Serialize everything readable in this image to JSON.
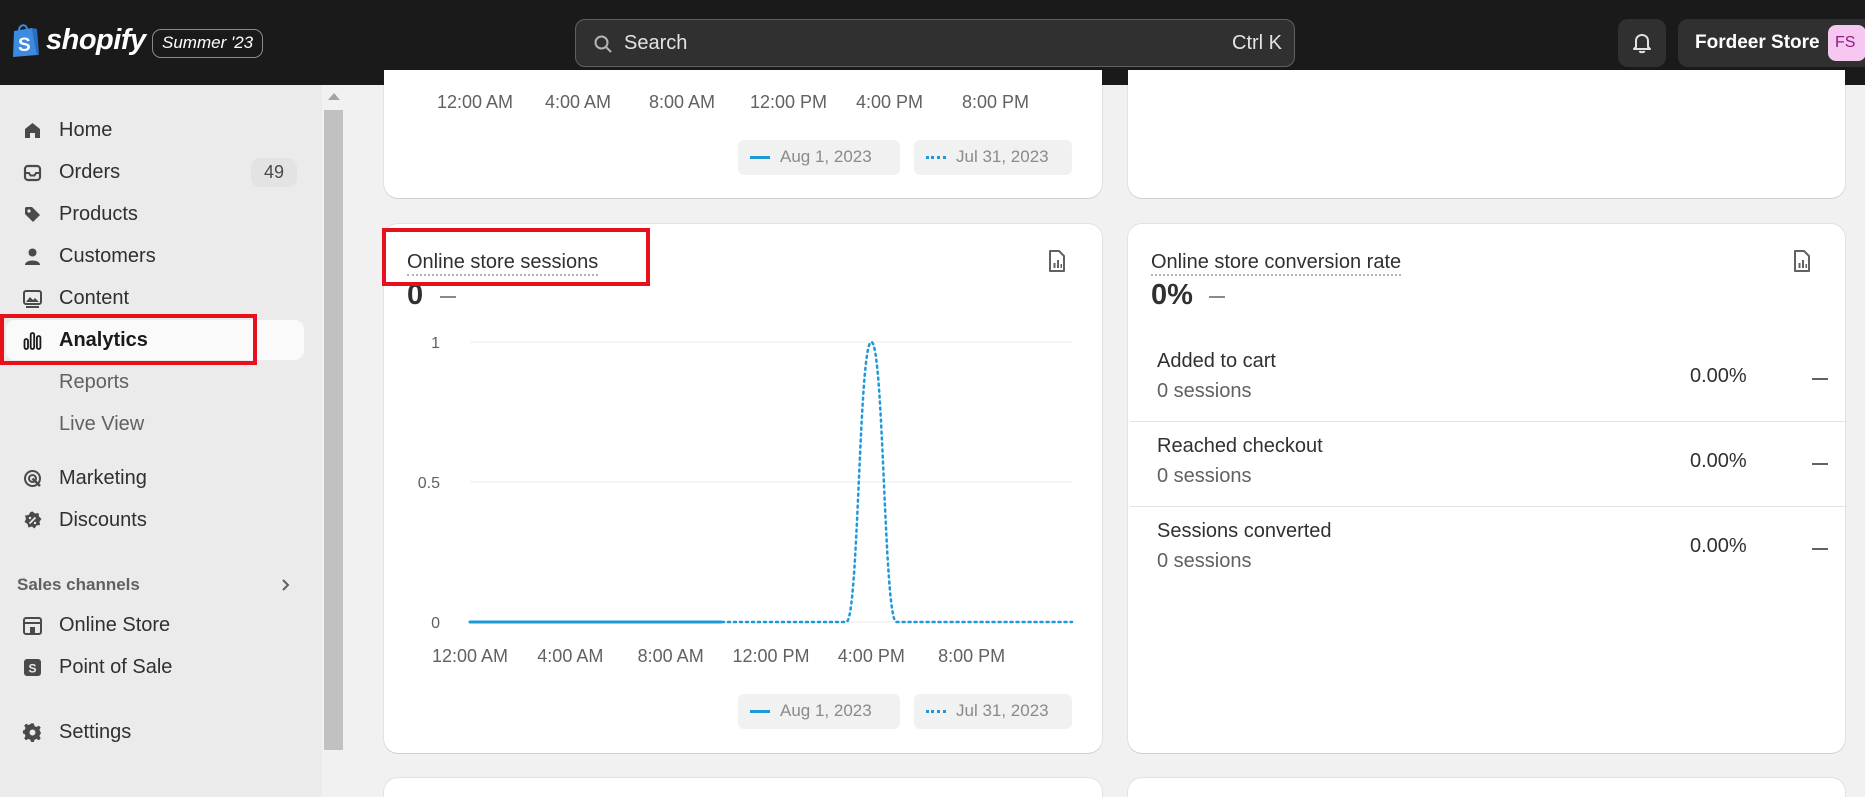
{
  "topbar": {
    "brand": "shopify",
    "edition": "Summer '23",
    "search_placeholder": "Search",
    "search_shortcut": "Ctrl K",
    "store_name": "Fordeer Store",
    "avatar_initials": "FS"
  },
  "sidebar": {
    "items": [
      {
        "label": "Home",
        "icon": "home-icon"
      },
      {
        "label": "Orders",
        "icon": "inbox-icon",
        "badge": "49"
      },
      {
        "label": "Products",
        "icon": "tag-icon"
      },
      {
        "label": "Customers",
        "icon": "person-icon"
      },
      {
        "label": "Content",
        "icon": "image-icon"
      },
      {
        "label": "Analytics",
        "icon": "bar-chart-icon",
        "active": true
      },
      {
        "label": "Reports",
        "sub": true
      },
      {
        "label": "Live View",
        "sub": true
      },
      {
        "label": "Marketing",
        "icon": "target-icon"
      },
      {
        "label": "Discounts",
        "icon": "discount-icon"
      }
    ],
    "sales_channels_title": "Sales channels",
    "channels": [
      {
        "label": "Online Store",
        "icon": "store-icon"
      },
      {
        "label": "Point of Sale",
        "icon": "pos-icon"
      }
    ],
    "settings_label": "Settings"
  },
  "top_card": {
    "x_ticks": [
      "12:00 AM",
      "4:00 AM",
      "8:00 AM",
      "12:00 PM",
      "4:00 PM",
      "8:00 PM"
    ],
    "legend": [
      "Aug 1, 2023",
      "Jul 31, 2023"
    ]
  },
  "sessions_card": {
    "title": "Online store sessions",
    "value": "0",
    "legend": [
      "Aug 1, 2023",
      "Jul 31, 2023"
    ]
  },
  "conversion_card": {
    "title": "Online store conversion rate",
    "value": "0%",
    "rows": [
      {
        "label": "Added to cart",
        "sessions": "0 sessions",
        "pct": "0.00%"
      },
      {
        "label": "Reached checkout",
        "sessions": "0 sessions",
        "pct": "0.00%"
      },
      {
        "label": "Sessions converted",
        "sessions": "0 sessions",
        "pct": "0.00%"
      }
    ]
  },
  "chart_data": {
    "type": "line",
    "ylim": [
      0,
      1
    ],
    "y_ticks": [
      "1",
      "0.5",
      "0"
    ],
    "x_ticks": [
      "12:00 AM",
      "4:00 AM",
      "8:00 AM",
      "12:00 PM",
      "4:00 PM",
      "8:00 PM"
    ],
    "x": [
      "12:00 AM",
      "1:00 AM",
      "2:00 AM",
      "3:00 AM",
      "4:00 AM",
      "5:00 AM",
      "6:00 AM",
      "7:00 AM",
      "8:00 AM",
      "9:00 AM",
      "10:00 AM",
      "11:00 AM",
      "12:00 PM",
      "1:00 PM",
      "2:00 PM",
      "3:00 PM",
      "4:00 PM",
      "5:00 PM",
      "6:00 PM",
      "7:00 PM",
      "8:00 PM",
      "9:00 PM",
      "10:00 PM",
      "11:00 PM"
    ],
    "series": [
      {
        "name": "Aug 1, 2023",
        "style": "solid",
        "color": "#1e98d6",
        "values": [
          0,
          0,
          0,
          0,
          0,
          0,
          0,
          0,
          0,
          0,
          0
        ]
      },
      {
        "name": "Jul 31, 2023",
        "style": "dotted",
        "color": "#1e98d6",
        "values": [
          0,
          0,
          0,
          0,
          0,
          0,
          0,
          0,
          0,
          0,
          0,
          0,
          0,
          0,
          0,
          0,
          1,
          0,
          0,
          0,
          0,
          0,
          0,
          0
        ]
      }
    ]
  }
}
